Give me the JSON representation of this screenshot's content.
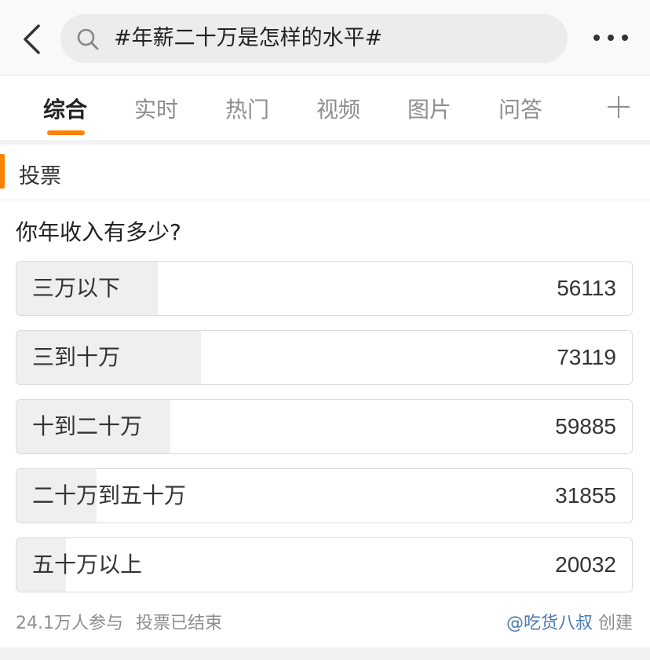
{
  "search": {
    "query": "#年薪二十万是怎样的水平#"
  },
  "icons": {
    "back": "chevron-left-icon",
    "search": "search-icon",
    "more": "more-dots-icon",
    "add": "plus-icon"
  },
  "tabs": [
    {
      "label": "综合",
      "active": true
    },
    {
      "label": "实时",
      "active": false
    },
    {
      "label": "热门",
      "active": false
    },
    {
      "label": "视频",
      "active": false
    },
    {
      "label": "图片",
      "active": false
    },
    {
      "label": "问答",
      "active": false
    }
  ],
  "vote": {
    "section_title": "投票",
    "question": "你年收入有多少?",
    "options": [
      {
        "label": "三万以下",
        "count": "56113",
        "share": 0.23
      },
      {
        "label": "三到十万",
        "count": "73119",
        "share": 0.3
      },
      {
        "label": "十到二十万",
        "count": "59885",
        "share": 0.25
      },
      {
        "label": "二十万到五十万",
        "count": "31855",
        "share": 0.13
      },
      {
        "label": "五十万以上",
        "count": "20032",
        "share": 0.08
      }
    ],
    "participants": "24.1万人参与",
    "status": "投票已结束",
    "author": "@吃货八叔",
    "created_label": "创建"
  },
  "colors": {
    "accent": "#ff8200",
    "author_link": "#4a79b2",
    "bar_fill": "#efefef"
  }
}
